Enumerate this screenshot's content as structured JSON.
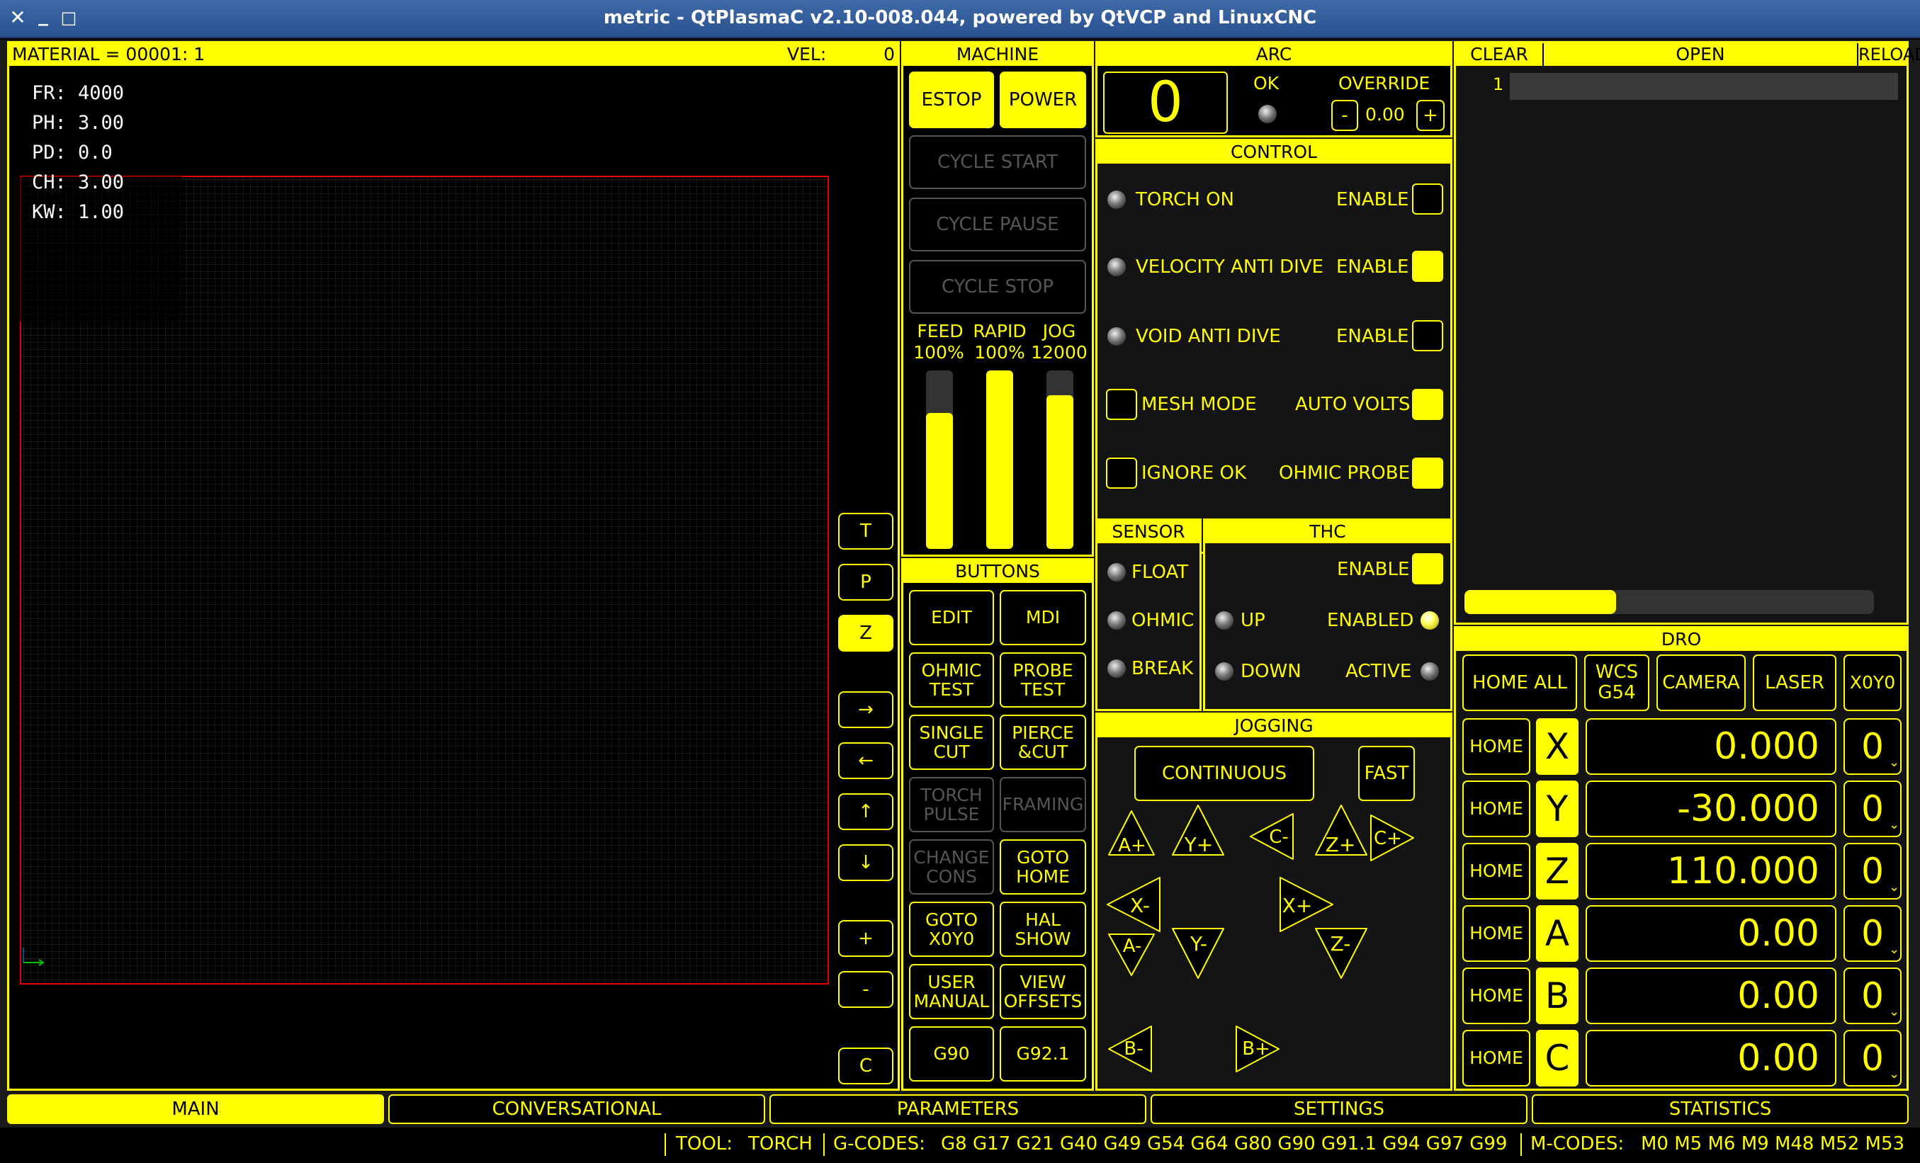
{
  "window": {
    "title": "metric - QtPlasmaC v2.10-008.044, powered by QtVCP and LinuxCNC"
  },
  "preview": {
    "material_label": "MATERIAL =  00001: 1",
    "vel_label": "VEL:",
    "vel_value": "0",
    "params": [
      "FR: 4000",
      "PH: 3.00",
      "PD: 0.0",
      "CH: 3.00",
      "KW: 1.00"
    ],
    "side_buttons": [
      "T",
      "P",
      "Z",
      "→",
      "←",
      "↑",
      "↓",
      "+",
      "-",
      "C"
    ]
  },
  "machine": {
    "header": "MACHINE",
    "estop": "ESTOP",
    "power": "POWER",
    "cycle_start": "CYCLE START",
    "cycle_pause": "CYCLE PAUSE",
    "cycle_stop": "CYCLE STOP",
    "sliders": [
      {
        "name": "FEED",
        "value": "100%",
        "level": 0.76
      },
      {
        "name": "RAPID",
        "value": "100%",
        "level": 1.0
      },
      {
        "name": "JOG",
        "value": "12000",
        "level": 0.86
      }
    ]
  },
  "buttons": {
    "header": "BUTTONS",
    "items": [
      [
        "EDIT",
        "MDI"
      ],
      [
        "OHMIC\nTEST",
        "PROBE\nTEST"
      ],
      [
        "SINGLE\nCUT",
        "PIERCE\n&CUT"
      ],
      [
        "TORCH\nPULSE",
        "FRAMING"
      ],
      [
        "CHANGE\nCONS",
        "GOTO\nHOME"
      ],
      [
        "GOTO\nX0Y0",
        "HAL\nSHOW"
      ],
      [
        "USER\nMANUAL",
        "VIEW\nOFFSETS"
      ],
      [
        "G90",
        "G92.1"
      ]
    ]
  },
  "arc": {
    "header": "ARC",
    "value": "0",
    "ok_label": "OK",
    "override_label": "OVERRIDE",
    "minus": "-",
    "override_value": "0.00",
    "plus": "+"
  },
  "control": {
    "header": "CONTROL",
    "torch_on": "TORCH ON",
    "velocity_anti_dive": "VELOCITY ANTI DIVE",
    "void_anti_dive": "VOID ANTI DIVE",
    "enable": "ENABLE",
    "mesh_mode": "MESH MODE",
    "auto_volts": "AUTO VOLTS",
    "ignore_ok": "IGNORE OK",
    "ohmic_probe": "OHMIC PROBE"
  },
  "sensor": {
    "header": "SENSOR",
    "float": "FLOAT",
    "ohmic": "OHMIC",
    "break": "BREAK"
  },
  "thc": {
    "header": "THC",
    "enable": "ENABLE",
    "up": "UP",
    "enabled": "ENABLED",
    "down": "DOWN",
    "active": "ACTIVE"
  },
  "jogging": {
    "header": "JOGGING",
    "continuous": "CONTINUOUS",
    "fast": "FAST",
    "keys": [
      "A+",
      "Y+",
      "C-",
      "Z+",
      "C+",
      "X-",
      "X+",
      "A-",
      "Y-",
      "Z-",
      "B-",
      "B+"
    ]
  },
  "gcode": {
    "clear": "CLEAR",
    "open": "OPEN",
    "reload": "RELOAD",
    "line_number": "1",
    "progress": 0.37
  },
  "dro": {
    "header": "DRO",
    "home_all": "HOME ALL",
    "wcs": "WCS\nG54",
    "camera": "CAMERA",
    "laser": "LASER",
    "x0y0": "X0Y0",
    "home": "HOME",
    "axes": [
      {
        "axis": "X",
        "value": "0.000",
        "sel": "0"
      },
      {
        "axis": "Y",
        "value": "-30.000",
        "sel": "0"
      },
      {
        "axis": "Z",
        "value": "110.000",
        "sel": "0"
      },
      {
        "axis": "A",
        "value": "0.00",
        "sel": "0"
      },
      {
        "axis": "B",
        "value": "0.00",
        "sel": "0"
      },
      {
        "axis": "C",
        "value": "0.00",
        "sel": "0"
      }
    ]
  },
  "tabs": [
    "MAIN",
    "CONVERSATIONAL",
    "PARAMETERS",
    "SETTINGS",
    "STATISTICS"
  ],
  "status": {
    "tool_label": "TOOL:",
    "tool": "TORCH",
    "gcodes_label": "G-CODES:",
    "gcodes": "G8 G17 G21 G40 G49 G54 G64 G80 G90 G91.1 G94 G97 G99",
    "mcodes_label": "M-CODES:",
    "mcodes": "M0 M5 M6 M9 M48 M52 M53"
  }
}
